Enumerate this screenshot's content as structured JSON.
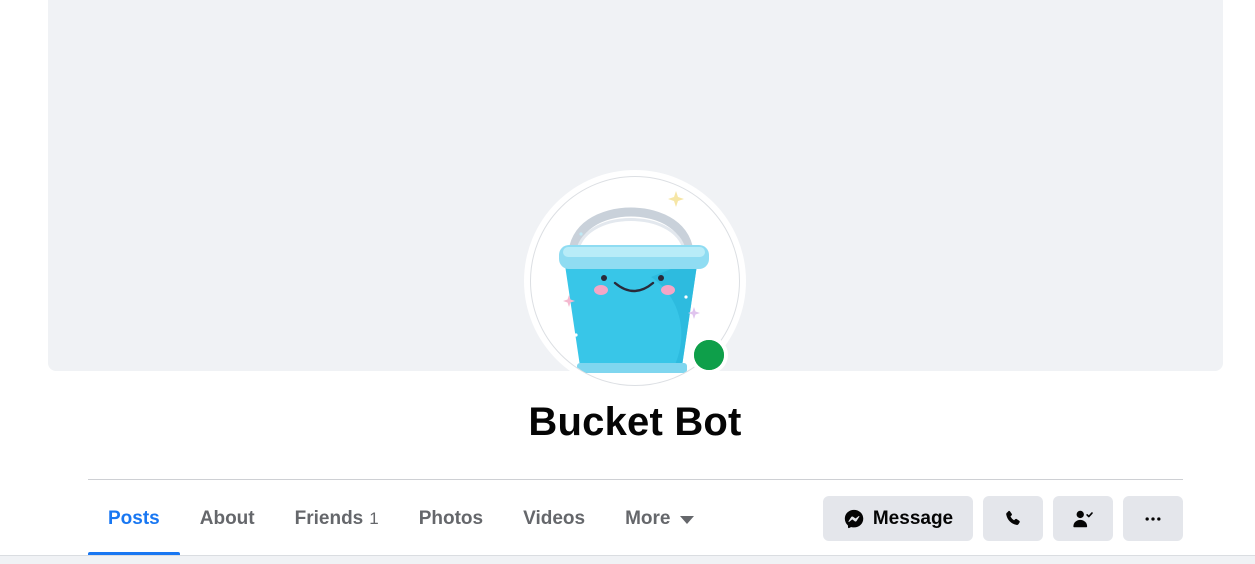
{
  "profile": {
    "name": "Bucket Bot",
    "online": true
  },
  "tabs": [
    {
      "label": "Posts",
      "active": true
    },
    {
      "label": "About"
    },
    {
      "label": "Friends",
      "count": "1"
    },
    {
      "label": "Photos"
    },
    {
      "label": "Videos"
    },
    {
      "label": "More",
      "icon": "caret-down-icon"
    }
  ],
  "actions": {
    "message_label": "Message",
    "message_icon": "messenger-icon",
    "call_icon": "phone-icon",
    "friends_icon": "person-check-icon",
    "more_icon": "ellipsis-icon"
  },
  "colors": {
    "accent": "#1877f2",
    "online": "#31a24c",
    "button_bg": "#e4e6eb",
    "cover_bg": "#f0f2f5"
  }
}
